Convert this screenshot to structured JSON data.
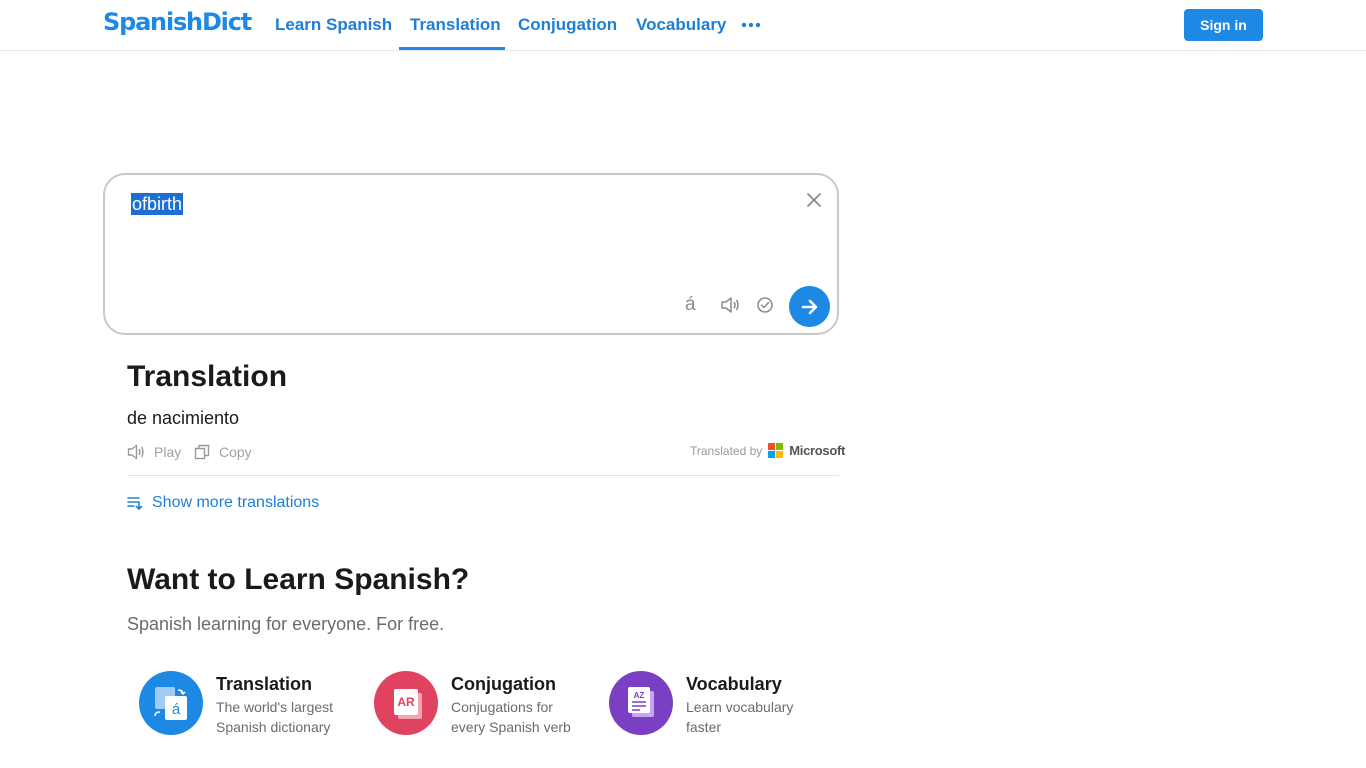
{
  "header": {
    "logo": "SpanishDict",
    "nav": [
      {
        "label": "Learn Spanish"
      },
      {
        "label": "Translation"
      },
      {
        "label": "Conjugation"
      },
      {
        "label": "Vocabulary"
      }
    ],
    "active_tab": "Translation",
    "more_icon": "more-dots-icon",
    "signin_label": "Sign in"
  },
  "translator": {
    "input_value": "ofbirth",
    "accent_label": "á",
    "icons": [
      "close-icon",
      "accent-icon",
      "speaker-icon",
      "spellcheck-icon",
      "arrow-right-icon"
    ]
  },
  "result": {
    "heading": "Translation",
    "text": "de nacimiento",
    "play_label": "Play",
    "copy_label": "Copy",
    "translated_by": "Translated by",
    "provider": "Microsoft",
    "show_more": "Show more translations"
  },
  "learn": {
    "heading": "Want to Learn Spanish?",
    "subheading": "Spanish learning for everyone. For free.",
    "features": [
      {
        "title": "Translation",
        "desc_line1": "The world's largest",
        "desc_line2": "Spanish dictionary",
        "color": "#1e88e5"
      },
      {
        "title": "Conjugation",
        "desc_line1": "Conjugations for",
        "desc_line2": "every Spanish verb",
        "color": "#e0435f"
      },
      {
        "title": "Vocabulary",
        "desc_line1": "Learn vocabulary",
        "desc_line2": "faster",
        "color": "#7b3fc4"
      }
    ]
  },
  "colors": {
    "accent": "#1e88e5",
    "selection": "#1d6fd1"
  }
}
